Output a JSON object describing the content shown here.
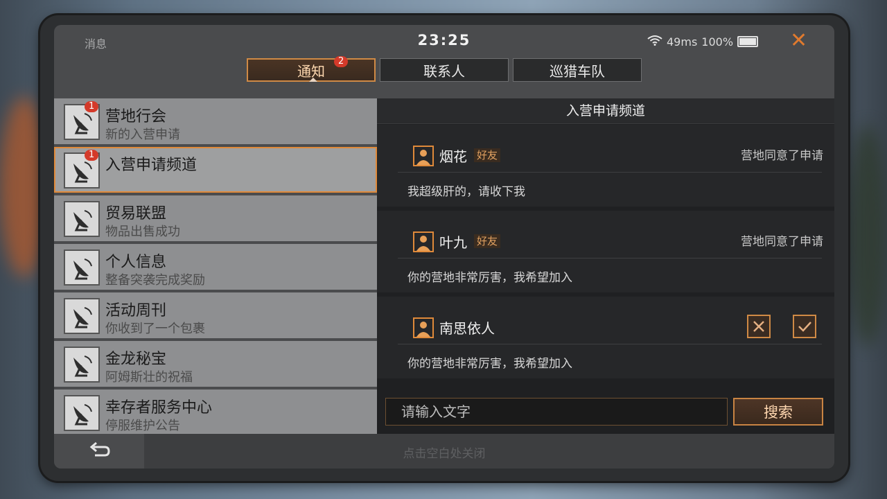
{
  "status": {
    "title": "消息",
    "time": "23:25",
    "ping": "49ms",
    "battery": "100%"
  },
  "tabs": [
    {
      "label": "通知",
      "badge": "2"
    },
    {
      "label": "联系人"
    },
    {
      "label": "巡猎车队"
    }
  ],
  "sidebar": {
    "items": [
      {
        "title": "营地行会",
        "subtitle": "新的入营申请",
        "badge": "1"
      },
      {
        "title": "入营申请频道",
        "subtitle": "",
        "badge": "1"
      },
      {
        "title": "贸易联盟",
        "subtitle": "物品出售成功"
      },
      {
        "title": "个人信息",
        "subtitle": "整备突袭完成奖励"
      },
      {
        "title": "活动周刊",
        "subtitle": "你收到了一个包裹"
      },
      {
        "title": "金龙秘宝",
        "subtitle": "阿姆斯壮的祝福"
      },
      {
        "title": "幸存者服务中心",
        "subtitle": "停服维护公告"
      }
    ]
  },
  "channel": {
    "title": "入营申请频道",
    "messages": [
      {
        "name": "烟花",
        "tag": "好友",
        "status": "营地同意了申请",
        "text": "我超级肝的，请收下我"
      },
      {
        "name": "叶九",
        "tag": "好友",
        "status": "营地同意了申请",
        "text": "你的营地非常厉害，我希望加入"
      },
      {
        "name": "南思依人",
        "tag": "",
        "status": "",
        "text": "你的营地非常厉害，我希望加入"
      }
    ]
  },
  "search": {
    "placeholder": "请输入文字",
    "button": "搜索"
  },
  "footer": {
    "hint": "点击空白处关闭"
  },
  "colors": {
    "accent": "#e08a3a",
    "badge": "#d43a2a",
    "panel_dark": "#1f2022",
    "list_item": "#8e8f91"
  },
  "icons": {
    "close": "close-icon",
    "back": "back-arrow-icon",
    "avatar": "satellite-dish-icon",
    "user": "user-icon",
    "reject": "x-icon",
    "accept": "check-icon"
  }
}
